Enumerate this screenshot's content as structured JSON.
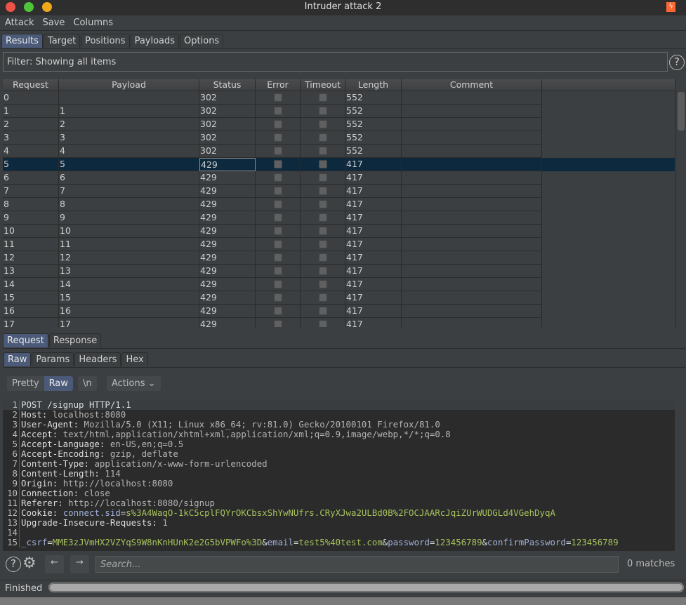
{
  "window": {
    "title": "Intruder attack 2",
    "traffic_lights": [
      "#ee5148",
      "#4ec43a",
      "#f0a91a"
    ],
    "app_icon": "burp-lightning-icon"
  },
  "menu": [
    "Attack",
    "Save",
    "Columns"
  ],
  "main_tabs": [
    "Results",
    "Target",
    "Positions",
    "Payloads",
    "Options"
  ],
  "filter": "Filter: Showing all items",
  "table": {
    "columns": [
      "Request",
      "Payload",
      "Status",
      "Error",
      "Timeout",
      "Length",
      "Comment"
    ],
    "selected_row": 5,
    "rows": [
      [
        "0",
        "",
        "302",
        "552"
      ],
      [
        "1",
        "1",
        "302",
        "552"
      ],
      [
        "2",
        "2",
        "302",
        "552"
      ],
      [
        "3",
        "3",
        "302",
        "552"
      ],
      [
        "4",
        "4",
        "302",
        "552"
      ],
      [
        "5",
        "5",
        "429",
        "417"
      ],
      [
        "6",
        "6",
        "429",
        "417"
      ],
      [
        "7",
        "7",
        "429",
        "417"
      ],
      [
        "8",
        "8",
        "429",
        "417"
      ],
      [
        "9",
        "9",
        "429",
        "417"
      ],
      [
        "10",
        "10",
        "429",
        "417"
      ],
      [
        "11",
        "11",
        "429",
        "417"
      ],
      [
        "12",
        "12",
        "429",
        "417"
      ],
      [
        "13",
        "13",
        "429",
        "417"
      ],
      [
        "14",
        "14",
        "429",
        "417"
      ],
      [
        "15",
        "15",
        "429",
        "417"
      ],
      [
        "16",
        "16",
        "429",
        "417"
      ],
      [
        "17",
        "17",
        "429",
        "417"
      ]
    ]
  },
  "detail_tabs": [
    "Request",
    "Response"
  ],
  "view_tabs": [
    "Raw",
    "Params",
    "Headers",
    "Hex"
  ],
  "toolbar": {
    "pretty": "Pretty",
    "raw": "Raw",
    "newline": "\\n",
    "actions": "Actions"
  },
  "editor": {
    "lines": [
      [
        [
          "k",
          "POST /signup HTTP/1.1"
        ]
      ],
      [
        [
          "k",
          "Host: "
        ],
        [
          "v",
          "localhost:8080"
        ]
      ],
      [
        [
          "k",
          "User-Agent: "
        ],
        [
          "v",
          "Mozilla/5.0 (X11; Linux x86_64; rv:81.0) Gecko/20100101 Firefox/81.0"
        ]
      ],
      [
        [
          "k",
          "Accept: "
        ],
        [
          "v",
          "text/html,application/xhtml+xml,application/xml;q=0.9,image/webp,*/*;q=0.8"
        ]
      ],
      [
        [
          "k",
          "Accept-Language: "
        ],
        [
          "v",
          "en-US,en;q=0.5"
        ]
      ],
      [
        [
          "k",
          "Accept-Encoding: "
        ],
        [
          "v",
          "gzip, deflate"
        ]
      ],
      [
        [
          "k",
          "Content-Type: "
        ],
        [
          "v",
          "application/x-www-form-urlencoded"
        ]
      ],
      [
        [
          "k",
          "Content-Length: "
        ],
        [
          "v",
          "114"
        ]
      ],
      [
        [
          "k",
          "Origin: "
        ],
        [
          "v",
          "http://localhost:8080"
        ]
      ],
      [
        [
          "k",
          "Connection: "
        ],
        [
          "v",
          "close"
        ]
      ],
      [
        [
          "k",
          "Referer: "
        ],
        [
          "v",
          "http://localhost:8080/signup"
        ]
      ],
      [
        [
          "k",
          "Cookie: "
        ],
        [
          "n",
          "connect.sid"
        ],
        [
          "k",
          "="
        ],
        [
          "g",
          "s%3A4WaqO-1kC5cplFQYrOKCbsxShYwNUfrs.CRyXJwa2ULBd0B%2FOCJAARcJqiZUrWUDGLd4VGehDyqA"
        ]
      ],
      [
        [
          "k",
          "Upgrade-Insecure-Requests: "
        ],
        [
          "v",
          "1"
        ]
      ],
      [],
      [
        [
          "n",
          "_csrf"
        ],
        [
          "k",
          "="
        ],
        [
          "g",
          "MME3zJVmHX2VZYqS9W8nKnHUnK2e2G5bVPWFo%3D"
        ],
        [
          "k",
          "&"
        ],
        [
          "n",
          "email"
        ],
        [
          "k",
          "="
        ],
        [
          "g",
          "test5%40test.com"
        ],
        [
          "k",
          "&"
        ],
        [
          "n",
          "password"
        ],
        [
          "k",
          "="
        ],
        [
          "g",
          "123456789"
        ],
        [
          "k",
          "&"
        ],
        [
          "n",
          "confirmPassword"
        ],
        [
          "k",
          "="
        ],
        [
          "g",
          "123456789"
        ]
      ]
    ]
  },
  "search": {
    "placeholder": "Search...",
    "matches": "0 matches"
  },
  "status": {
    "text": "Finished",
    "progress": 1.0
  }
}
